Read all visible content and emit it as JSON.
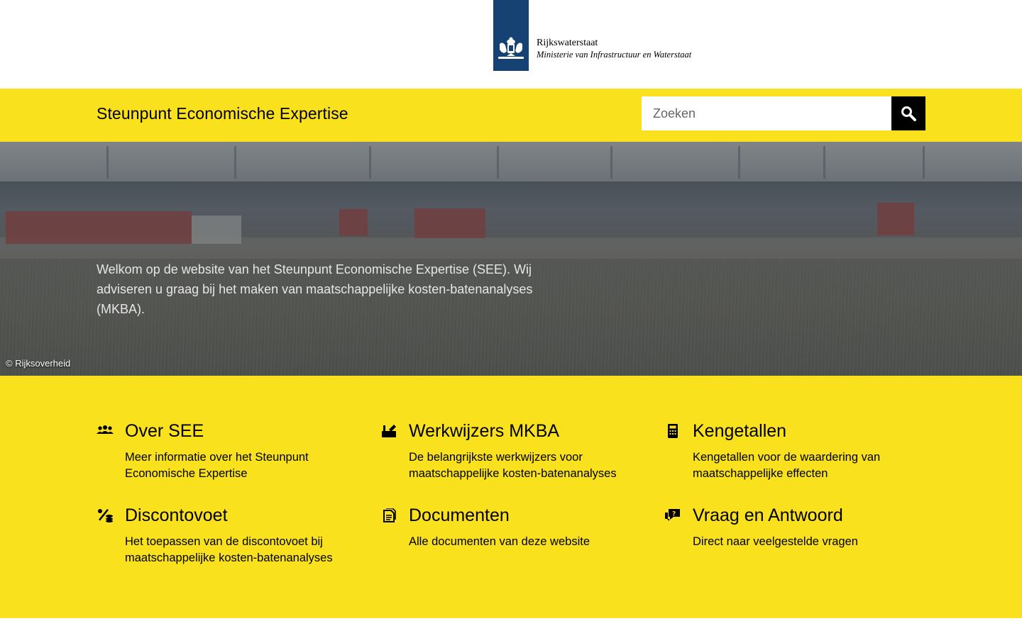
{
  "header": {
    "org_name": "Rijkswaterstaat",
    "ministry": "Ministerie van Infrastructuur en Waterstaat"
  },
  "title_bar": {
    "site_title": "Steunpunt Economische Expertise",
    "search_placeholder": "Zoeken"
  },
  "hero": {
    "intro": "Welkom op de website van het Steunpunt Economische Expertise (SEE). Wij adviseren u graag bij het maken van maatschappelijke kosten-batenanalyses (MKBA).",
    "credit": "© Rijksoverheid"
  },
  "tiles": [
    {
      "icon": "people-icon",
      "title": "Over SEE",
      "description": "Meer informatie over het Steunpunt Economische Expertise"
    },
    {
      "icon": "toolbox-icon",
      "title": "Werkwijzers MKBA",
      "description": "De belangrijkste werkwijzers voor maatschappelijke kosten-batenanalyses"
    },
    {
      "icon": "calculator-icon",
      "title": "Kengetallen",
      "description": "Kengetallen voor de waardering van maatschappelijke effecten"
    },
    {
      "icon": "percent-coins-icon",
      "title": "Discontovoet",
      "description": "Het toepassen van de discontovoet bij maatschappelijke kosten-batenanalyses"
    },
    {
      "icon": "document-icon",
      "title": "Documenten",
      "description": "Alle documenten van deze website"
    },
    {
      "icon": "question-chat-icon",
      "title": "Vraag en Antwoord",
      "description": "Direct naar veelgestelde vragen"
    }
  ],
  "colors": {
    "brand_yellow": "#f9e11e",
    "logo_blue": "#154273"
  }
}
